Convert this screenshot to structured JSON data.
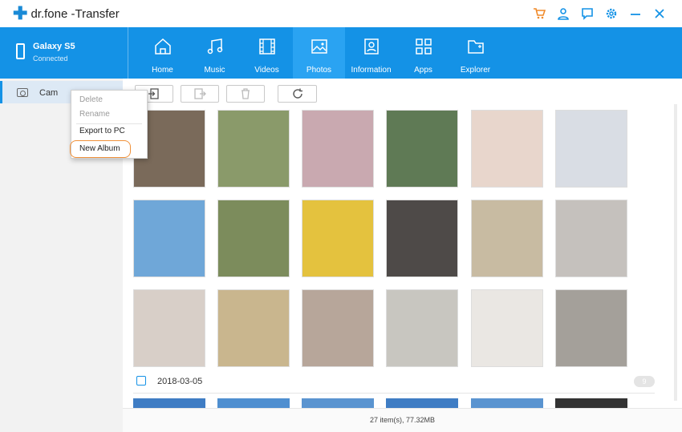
{
  "app": {
    "title": "dr.fone -Transfer",
    "brand_color": "#1492e6"
  },
  "titlebar_icons": [
    "cart-icon",
    "user-icon",
    "feedback-icon",
    "settings-icon",
    "minimize-icon",
    "close-icon"
  ],
  "device": {
    "name": "Galaxy S5",
    "status": "Connected"
  },
  "tabs": [
    {
      "label": "Home",
      "icon": "home-icon",
      "active": false
    },
    {
      "label": "Music",
      "icon": "music-icon",
      "active": false
    },
    {
      "label": "Videos",
      "icon": "videos-icon",
      "active": false
    },
    {
      "label": "Photos",
      "icon": "photos-icon",
      "active": true
    },
    {
      "label": "Information",
      "icon": "information-icon",
      "active": false
    },
    {
      "label": "Apps",
      "icon": "apps-icon",
      "active": false
    },
    {
      "label": "Explorer",
      "icon": "explorer-icon",
      "active": false
    }
  ],
  "sidebar": {
    "items": [
      {
        "label": "Cam",
        "icon": "camera-icon"
      }
    ]
  },
  "context_menu": {
    "items": [
      {
        "label": "Delete",
        "enabled": false
      },
      {
        "label": "Rename",
        "enabled": false
      },
      {
        "label": "Export to PC",
        "enabled": true
      },
      {
        "label": "New Album",
        "enabled": true,
        "highlighted": true
      }
    ]
  },
  "toolbar": {
    "buttons": [
      "import-icon",
      "export-icon",
      "trash-icon",
      "refresh-icon"
    ]
  },
  "photos": {
    "rows": [
      [
        "#7a6a5a",
        "#8a9a6a",
        "#c9a9b0",
        "#5f7a55",
        "#e8d6cc",
        "#d9dde4"
      ],
      [
        "#6fa7d8",
        "#7c8c5c",
        "#e4c23e",
        "#4e4a48",
        "#c8bba2",
        "#c5c1bd"
      ],
      [
        "#d8cfc8",
        "#c9b68e",
        "#b7a69a",
        "#c8c6c0",
        "#eae7e3",
        "#a4a09a"
      ]
    ],
    "group_date": "2018-03-05",
    "group_count": "9",
    "strip_colors": [
      "#3f7dc4",
      "#4f8fd0",
      "#5a94d0",
      "#3f7dc4",
      "#5a94d0",
      "#333333"
    ]
  },
  "status": {
    "text": "27 item(s), 77.32MB"
  }
}
